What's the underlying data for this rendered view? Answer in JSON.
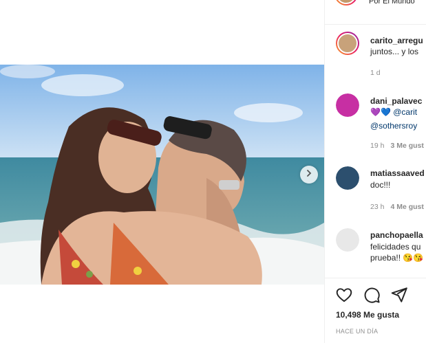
{
  "header": {
    "location": "Por El Mundo"
  },
  "caption": {
    "username": "carito_arregu",
    "text": "juntos... y los",
    "time": "1 d"
  },
  "comments": [
    {
      "username": "dani_palavec",
      "emoji": "💜💙",
      "line1_mention": "@carit",
      "line2_mention": "@sothersroy",
      "time": "19 h",
      "likes": "3 Me gust"
    },
    {
      "username": "matiassaaved",
      "line1": "doc!!!",
      "time": "23 h",
      "likes": "4 Me gust"
    },
    {
      "username": "panchopaella",
      "line1": "felicidades qu",
      "line2": "prueba!! 😘😘"
    }
  ],
  "footer": {
    "likes": "10,498 Me gusta",
    "time_ago": "HACE UN DÍA"
  },
  "icons": {
    "next": "chevron-right-icon",
    "like": "heart-icon",
    "comment": "comment-bubble-icon",
    "share": "paper-plane-icon"
  },
  "colors": {
    "text": "#262626",
    "muted": "#8e8e8e",
    "mention": "#00376b",
    "divider": "#efefef"
  }
}
